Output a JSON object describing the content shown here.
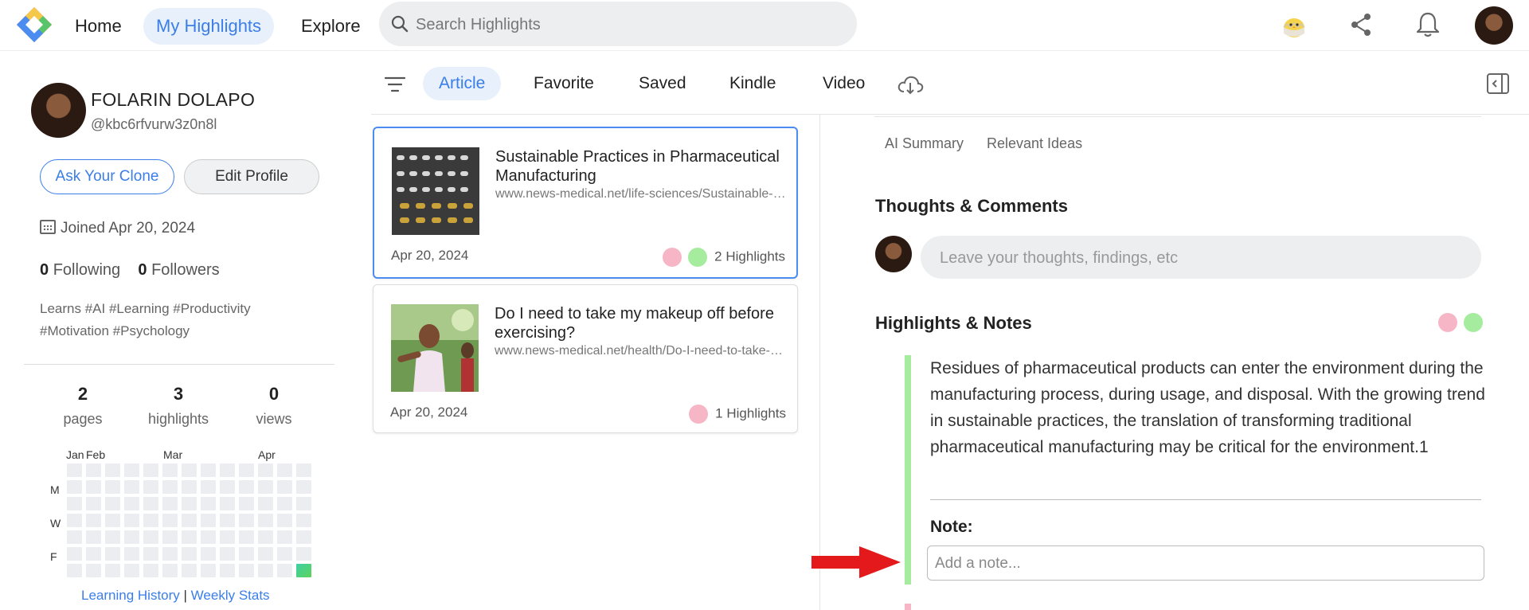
{
  "nav": {
    "home": "Home",
    "my_highlights": "My Highlights",
    "explore": "Explore",
    "search_placeholder": "Search Highlights"
  },
  "header_icons": [
    "chick-icon",
    "share-icon",
    "bell-icon",
    "user-avatar"
  ],
  "profile": {
    "name": "FOLARIN DOLAPO",
    "handle": "@kbc6rfvurw3z0n8l",
    "ask_clone": "Ask Your Clone",
    "edit_profile": "Edit Profile",
    "joined": "Joined Apr 20, 2024",
    "following_count": "0",
    "following_label": "Following",
    "followers_count": "0",
    "followers_label": "Followers",
    "tags": "Learns #AI #Learning #Productivity #Motivation #Psychology",
    "stats": [
      {
        "num": "2",
        "label": "pages"
      },
      {
        "num": "3",
        "label": "highlights"
      },
      {
        "num": "0",
        "label": "views"
      }
    ],
    "heatmap": {
      "months": [
        "Jan",
        "Feb",
        "Mar",
        "Apr"
      ],
      "days": [
        "M",
        "W",
        "F"
      ],
      "active_cells": 1
    },
    "link_history": "Learning History",
    "link_sep": "|",
    "link_weekly": "Weekly Stats"
  },
  "filters": {
    "tabs": [
      "Article",
      "Favorite",
      "Saved",
      "Kindle",
      "Video"
    ],
    "active": "Article"
  },
  "cards": [
    {
      "title": "Sustainable Practices in Pharmaceutical Manufacturing",
      "url": "www.news-medical.net/life-sciences/Sustainable-Practices-in-Pharmaceutical-Manufacturing",
      "date": "Apr 20, 2024",
      "highlights": "2 Highlights",
      "dots": [
        "pink",
        "green"
      ]
    },
    {
      "title": "Do I need to take my makeup off before exercising?",
      "url": "www.news-medical.net/health/Do-I-need-to-take-my-makeup-off-before-exercising",
      "date": "Apr 20, 2024",
      "highlights": "1 Highlights",
      "dots": [
        "pink"
      ]
    }
  ],
  "detail": {
    "subtabs": [
      "AI Summary",
      "Relevant Ideas"
    ],
    "thoughts_title": "Thoughts & Comments",
    "comment_placeholder": "Leave your thoughts, findings, etc",
    "highlights_title": "Highlights & Notes",
    "highlight_text": "Residues of pharmaceutical products can enter the environment during the manufacturing process, during usage, and disposal. With the growing trend in sustainable practices, the translation of transforming traditional pharmaceutical manufacturing may be critical for the environment.1",
    "note_label": "Note:",
    "note_placeholder": "Add a note..."
  },
  "colors": {
    "accent": "#3b7ee8",
    "highlight_green": "#a6ec9e",
    "highlight_pink": "#f7b6c6",
    "annotation_arrow": "#e3191c"
  }
}
